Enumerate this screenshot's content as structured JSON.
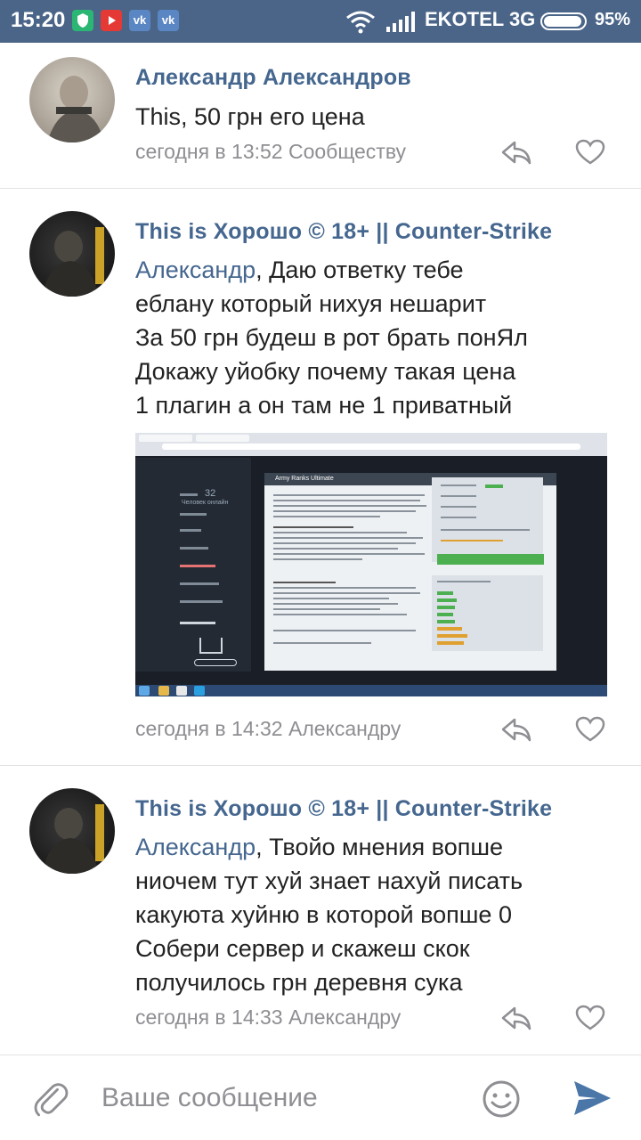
{
  "status_bar": {
    "time": "15:20",
    "notification_icons": [
      "shield-icon",
      "youtube-icon",
      "vk-icon",
      "vk-icon"
    ],
    "carrier": "EKOTEL 3G",
    "battery": "95%",
    "battery_level": 0.95
  },
  "comments": [
    {
      "author": "Александр Александров",
      "mention": "",
      "text_lines": [
        "This, 50 грн его цена"
      ],
      "meta": "сегодня в 13:52 Сообществу"
    },
    {
      "author": "This is Хорошо © 18+ || Counter-Strike",
      "mention": "Александр",
      "first_line_rest": ", Даю ответку тебе",
      "text_lines": [
        "еблану который нихуя нешарит",
        "За 50 грн будеш в рот брать понЯл",
        "Докажу уйобку почему такая цена",
        "1 плагин а он там не 1 приватный"
      ],
      "meta": "сегодня в 14:32 Александру"
    },
    {
      "author": "This is Хорошо © 18+ || Counter-Strike",
      "mention": "Александр",
      "first_line_rest": ", Твойо мнения вопше",
      "text_lines": [
        "ниочем тут хуй знает нахуй писать",
        "какуюта хуйню в которой вопше 0",
        "Собери сервер и скажеш скок",
        "получилось грн деревня сука"
      ],
      "meta": "сегодня в 14:33 Александру"
    }
  ],
  "attachment": {
    "sidebar_count": "32",
    "sidebar_label": "Человек онлайн",
    "panel_title": "Army Ranks Ultimate"
  },
  "composer": {
    "placeholder": "Ваше сообщение"
  },
  "colors": {
    "status_bar": "#4a6588",
    "link": "#45678f",
    "meta": "#8e8e93",
    "send": "#4a76a8"
  }
}
